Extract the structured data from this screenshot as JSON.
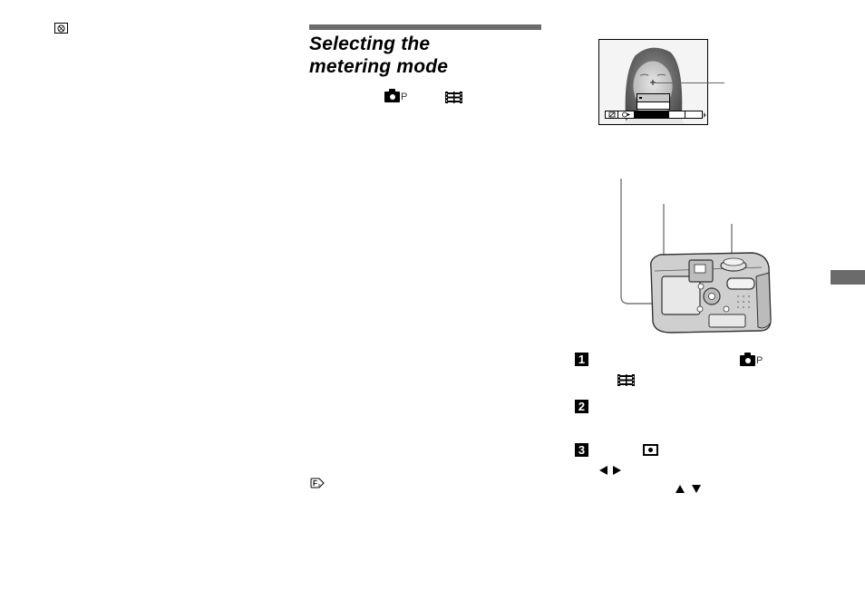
{
  "page": {
    "title_line1": "Selecting the",
    "title_line2": "metering mode",
    "accent_color": "#6b6b6b"
  },
  "icons": {
    "left_column": "spot-metering-icon",
    "mode_still": "camera-program-mode-icon",
    "mode_still_letter": "P",
    "mode_movie": "movie-film-icon",
    "footer_note": "fs-function-icon",
    "step3_spot": "spot-metering-icon",
    "arrows": [
      "left-arrow-icon",
      "right-arrow-icon",
      "up-arrow-icon",
      "down-arrow-icon"
    ]
  },
  "lcd_preview": {
    "description": "LCD screen preview showing portrait with spot-metering cross hair",
    "menu_bar_cells": [
      "",
      "",
      "",
      "",
      ""
    ],
    "selected_menu_item": ""
  },
  "steps": [
    {
      "number": "1",
      "icons": [
        "camera-program-mode-icon",
        "movie-film-icon"
      ],
      "mode_letter": "P"
    },
    {
      "number": "2",
      "icons": []
    },
    {
      "number": "3",
      "icons": [
        "spot-metering-icon",
        "left-arrow-icon",
        "right-arrow-icon",
        "up-arrow-icon",
        "down-arrow-icon"
      ]
    }
  ],
  "illustration": {
    "subject": "digital camera rear view with callout lines"
  }
}
